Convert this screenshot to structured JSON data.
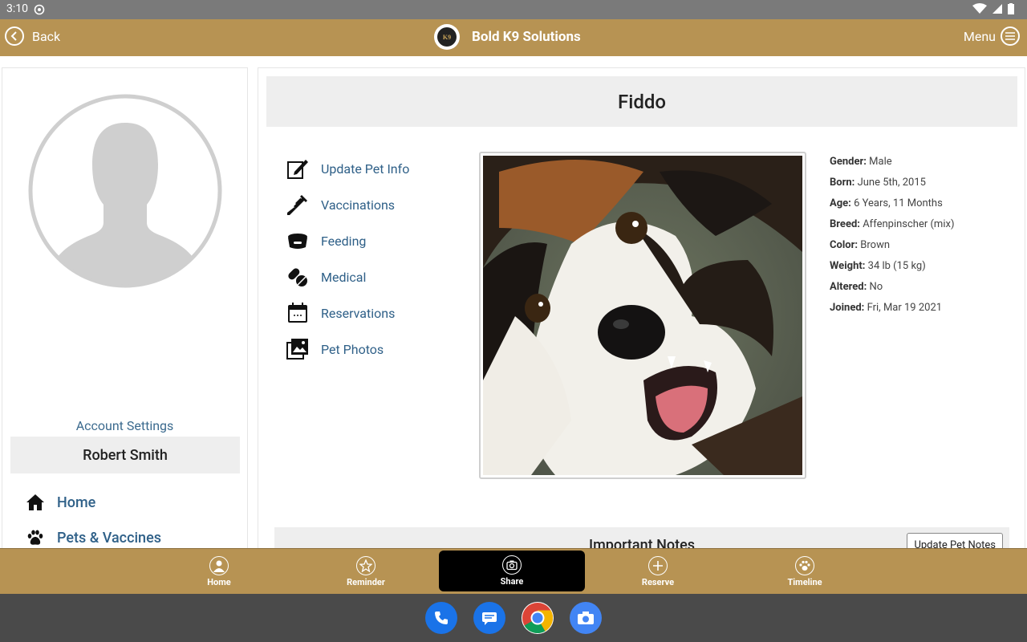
{
  "status_bar": {
    "time": "3:10"
  },
  "app_bar": {
    "back_label": "Back",
    "brand_name": "Bold K9 Solutions",
    "logo_text": "K9",
    "menu_label": "Menu"
  },
  "left": {
    "account_settings": "Account Settings",
    "user_name": "Robert Smith",
    "nav": [
      {
        "label": "Home",
        "icon": "house-icon"
      },
      {
        "label": "Pets & Vaccines",
        "icon": "paw-icon"
      }
    ]
  },
  "pet": {
    "name": "Fiddo",
    "menu": [
      {
        "label": "Update Pet Info",
        "icon": "edit-icon"
      },
      {
        "label": "Vaccinations",
        "icon": "syringe-icon"
      },
      {
        "label": "Feeding",
        "icon": "food-bowl-icon"
      },
      {
        "label": "Medical",
        "icon": "pills-icon"
      },
      {
        "label": "Reservations",
        "icon": "calendar-icon"
      },
      {
        "label": "Pet Photos",
        "icon": "photos-icon"
      }
    ],
    "details": [
      {
        "label": "Gender:",
        "value": "Male"
      },
      {
        "label": "Born:",
        "value": "June 5th, 2015"
      },
      {
        "label": "Age:",
        "value": "6 Years, 11 Months"
      },
      {
        "label": "Breed:",
        "value": "Affenpinscher (mix)"
      },
      {
        "label": "Color:",
        "value": "Brown"
      },
      {
        "label": "Weight:",
        "value": "34 lb (15 kg)"
      },
      {
        "label": "Altered:",
        "value": "No"
      },
      {
        "label": "Joined:",
        "value": "Fri, Mar 19 2021"
      }
    ],
    "notes_title": "Important Notes",
    "notes_button": "Update Pet Notes"
  },
  "tabs": [
    {
      "label": "Home",
      "icon": "person-icon",
      "active": false
    },
    {
      "label": "Reminder",
      "icon": "star-icon",
      "active": false
    },
    {
      "label": "Share",
      "icon": "camera-icon",
      "active": true
    },
    {
      "label": "Reserve",
      "icon": "plus-icon",
      "active": false
    },
    {
      "label": "Timeline",
      "icon": "paw-icon",
      "active": false
    }
  ],
  "dock": [
    {
      "icon": "phone-icon",
      "color": "#1a73e8"
    },
    {
      "icon": "messages-icon",
      "color": "#1a73e8"
    },
    {
      "icon": "chrome-icon",
      "color": "#ffffff"
    },
    {
      "icon": "camera-app-icon",
      "color": "#4285f4"
    }
  ],
  "colors": {
    "brand_gold": "#b79353",
    "link_blue": "#2f6088"
  }
}
